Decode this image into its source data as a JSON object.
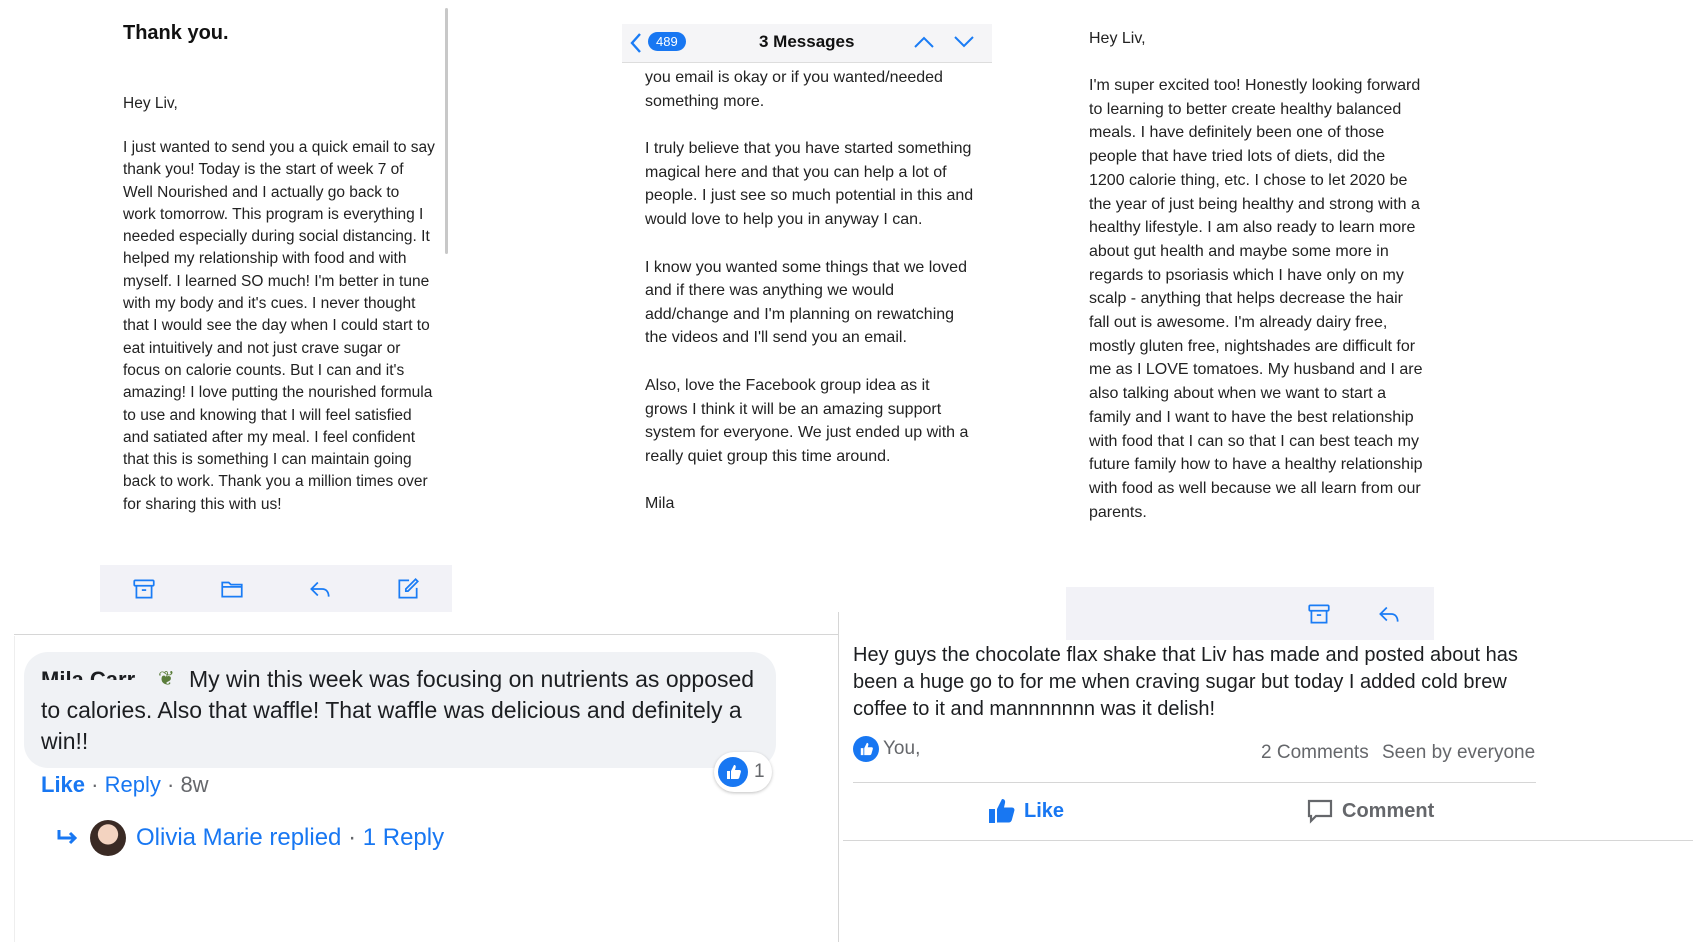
{
  "panel1": {
    "subject": "Thank you.",
    "greeting": "Hey Liv,",
    "body": "I just wanted to send you a quick email to say thank you! Today is the start of week 7 of Well Nourished and I actually go back to work tomorrow. This program is everything I needed especially during social distancing. It helped my relationship with food and with myself. I learned SO much! I'm better in tune with my body and it's cues. I never thought that I would see the day when I could start to eat intuitively and not just crave sugar or focus on calorie counts. But I can and it's amazing! I love putting the nourished formula to use and knowing that I will feel satisfied and satiated after my meal. I feel confident that this is something I can maintain going back to work. Thank you a million times over for sharing this with us!",
    "toolbar_icons": [
      "archive-icon",
      "folder-icon",
      "reply-icon",
      "compose-icon"
    ]
  },
  "panel2": {
    "back_count": "489",
    "title": "3 Messages",
    "paragraphs": [
      "you email is okay or if you wanted/needed something more.",
      "I truly believe that you have started something magical here and that you can help a lot of people. I just see so much potential in this and would love to help you in anyway I can.",
      "I know you wanted some things that we loved and if there was anything we would add/change and I'm planning on rewatching the videos and I'll send you an email.",
      "Also, love the Facebook group idea as it grows I think it will be an amazing support system for everyone. We just ended up with a really quiet group this time around.",
      "Mila"
    ]
  },
  "panel3": {
    "greeting": "Hey Liv,",
    "body": "I'm super excited too! Honestly looking forward to learning to better create healthy balanced meals. I have definitely been one of those people that have tried lots of diets, did the 1200 calorie thing, etc. I chose to let 2020 be the year of just being healthy and strong with a healthy lifestyle. I am also ready to learn more about gut health and maybe some more in regards to psoriasis which I have only on my scalp - anything that helps decrease the hair fall out is awesome. I'm already dairy free, mostly gluten free, nightshades are difficult for me as I LOVE tomatoes. My husband and I are also talking about when we want to start a family and I want to have the best relationship with food that I can so that I can best teach my future family how to have a healthy relationship with food as well because we all learn from our parents."
  },
  "comment": {
    "author": "Mila Carr..",
    "text": "My win this week was focusing on nutrients as opposed to calories. Also that waffle! That waffle was delicious and definitely a win!!",
    "reaction_count": "1",
    "like": "Like",
    "reply": "Reply",
    "age": "8w",
    "replied_text": "Olivia Marie replied",
    "reply_count": "1 Reply"
  },
  "post": {
    "text": "Hey guys the chocolate flax shake that Liv has made and posted about has been a huge go to for me when craving sugar but today I added cold brew coffee to it and mannnnnnn was it delish!",
    "reactors": "You, ",
    "comments": "2 Comments",
    "seen": "Seen by everyone",
    "like": "Like",
    "comment_btn": "Comment"
  },
  "colors": {
    "accent": "#1877f2",
    "ios_blue": "#1a7cf5",
    "bubble": "#f0f2f5",
    "toolbar": "#f2f2f7"
  }
}
